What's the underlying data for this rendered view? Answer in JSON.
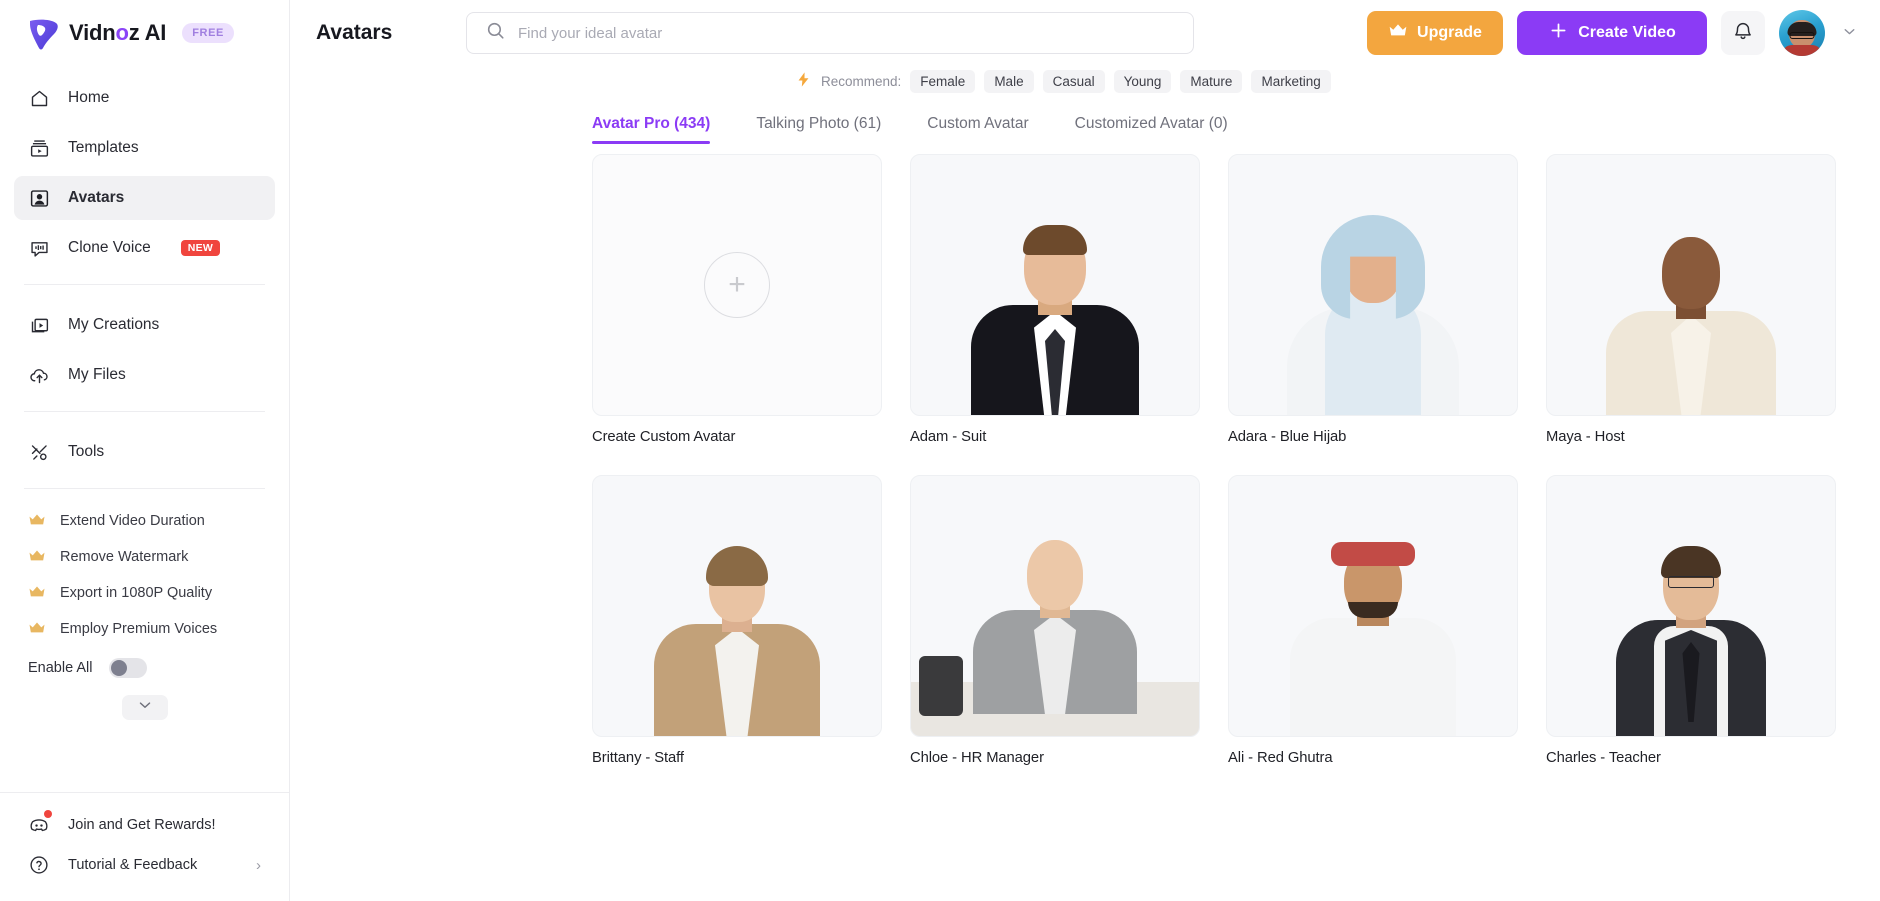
{
  "brand": {
    "name_part1": "Vidn",
    "name_o": "o",
    "name_part2": "z AI",
    "badge": "FREE",
    "logo_icon": "vidnoz-logo-icon"
  },
  "sidebar": {
    "items": [
      {
        "label": "Home",
        "icon": "home-icon"
      },
      {
        "label": "Templates",
        "icon": "templates-icon"
      },
      {
        "label": "Avatars",
        "icon": "avatars-icon",
        "active": true
      },
      {
        "label": "Clone Voice",
        "icon": "clone-voice-icon",
        "badge": "NEW"
      }
    ],
    "items2": [
      {
        "label": "My Creations",
        "icon": "my-creations-icon"
      },
      {
        "label": "My Files",
        "icon": "my-files-icon"
      }
    ],
    "items3": [
      {
        "label": "Tools",
        "icon": "tools-icon"
      }
    ],
    "perks": [
      {
        "label": "Extend Video Duration",
        "icon": "crown-icon"
      },
      {
        "label": "Remove Watermark",
        "icon": "crown-icon"
      },
      {
        "label": "Export in 1080P Quality",
        "icon": "crown-icon"
      },
      {
        "label": "Employ Premium Voices",
        "icon": "crown-icon"
      }
    ],
    "enable_all_label": "Enable All",
    "enable_all_state": "off",
    "collapse_icon": "chevron-down-icon",
    "footer": [
      {
        "label": "Join and Get Rewards!",
        "icon": "discord-icon",
        "has_dot": true
      },
      {
        "label": "Tutorial & Feedback",
        "icon": "question-circle-icon",
        "chevron": "›"
      }
    ]
  },
  "header": {
    "title": "Avatars",
    "search": {
      "placeholder": "Find your ideal avatar",
      "value": "",
      "icon": "search-icon"
    },
    "upgrade_label": "Upgrade",
    "upgrade_icon": "crown-icon",
    "create_label": "Create Video",
    "create_icon": "plus-icon",
    "notification_icon": "bell-icon",
    "avatar_icon": "user-avatar",
    "account_chevron_icon": "chevron-down-icon"
  },
  "recommend": {
    "icon": "lightning-bolt-icon",
    "label": "Recommend:",
    "tags": [
      "Female",
      "Male",
      "Casual",
      "Young",
      "Mature",
      "Marketing"
    ]
  },
  "tabs": [
    {
      "label": "Avatar Pro (434)",
      "active": true
    },
    {
      "label": "Talking Photo (61)",
      "active": false
    },
    {
      "label": "Custom Avatar",
      "active": false
    },
    {
      "label": "Customized Avatar (0)",
      "active": false
    }
  ],
  "cards": [
    {
      "label": "Create Custom Avatar",
      "kind": "create",
      "icon": "plus-icon"
    },
    {
      "label": "Adam - Suit",
      "kind": "figure",
      "skin": "#e7bb99",
      "hair": "#6d4a2c",
      "body": "#16161c",
      "shirt": "#ffffff",
      "tie": "#2b2c33"
    },
    {
      "label": "Adara - Blue Hijab",
      "kind": "figure",
      "skin": "#e3b08c",
      "hair": "#b9d4e4",
      "body": "#f2f4f6",
      "shirt": "#dfeaf2",
      "tie": ""
    },
    {
      "label": "Maya - Host",
      "kind": "figure",
      "skin": "#8a5a3b",
      "hair": "#1d1714",
      "body": "#efe7d8",
      "shirt": "#f7f2e8",
      "tie": ""
    },
    {
      "label": "Brittany - Staff",
      "kind": "figure",
      "skin": "#e9c3a3",
      "hair": "#8a6a45",
      "body": "#c2a179",
      "shirt": "#f3f2ee",
      "tie": ""
    },
    {
      "label": "Chloe - HR Manager",
      "kind": "figure",
      "skin": "#ecc8a8",
      "hair": "#ddc48a",
      "body": "#9ea0a2",
      "shirt": "#ececec",
      "tie": ""
    },
    {
      "label": "Ali - Red Ghutra",
      "kind": "figure",
      "skin": "#c9966a",
      "hair": "#c24b46",
      "body": "#f4f5f6",
      "shirt": "#fbfbfb",
      "tie": ""
    },
    {
      "label": "Charles - Teacher",
      "kind": "figure",
      "skin": "#e4bb98",
      "hair": "#4a3524",
      "body": "#2c2d33",
      "shirt": "#f2f2f2",
      "tie": "#1a1a1f"
    }
  ],
  "colors": {
    "accent": "#8b3bf5",
    "upgrade": "#f3a63f",
    "badge_new": "#f0453e",
    "tag_bg": "#f3f3f5"
  }
}
